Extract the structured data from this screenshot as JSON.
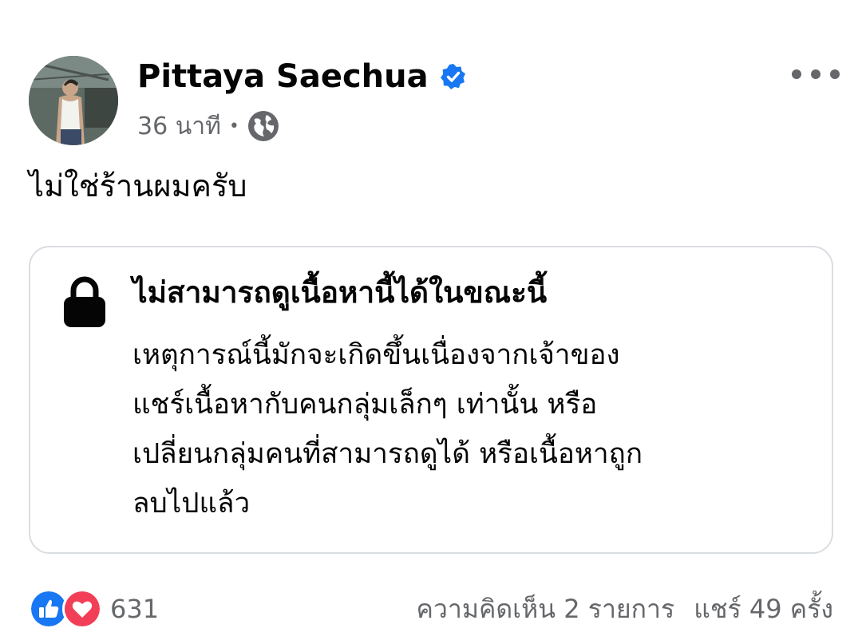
{
  "post": {
    "author": {
      "name": "Pittaya Saechua",
      "verified": true,
      "avatar_icon": "profile-photo"
    },
    "meta": {
      "time": "36 นาที",
      "separator": "•",
      "privacy_icon": "globe-icon"
    },
    "more_icon": "more-options-icon",
    "text": "ไม่ใช่ร้านผมครับ",
    "unavailable_card": {
      "icon": "lock-icon",
      "title": "ไม่สามารถดูเนื้อหานี้ได้ในขณะนี้",
      "body_lines": [
        "เหตุการณ์นี้มักจะเกิดขึ้นเนื่องจากเจ้าของ",
        "แชร์เนื้อหากับคนกลุ่มเล็กๆ เท่านั้น หรือ",
        "เปลี่ยนกลุ่มคนที่สามารถดูได้ หรือเนื้อหาถูก",
        "ลบไปแล้ว"
      ]
    },
    "footer": {
      "reaction_icons": [
        "like-icon",
        "love-icon"
      ],
      "reaction_count": "631",
      "comments": "ความคิดเห็น 2 รายการ",
      "shares": "แชร์ 49 ครั้ง"
    }
  },
  "colors": {
    "badge_blue": "#1877f2",
    "like_blue": "#1877f2",
    "love_red": "#f33e58",
    "secondary_text": "#65676b",
    "card_border": "#dadde1"
  }
}
